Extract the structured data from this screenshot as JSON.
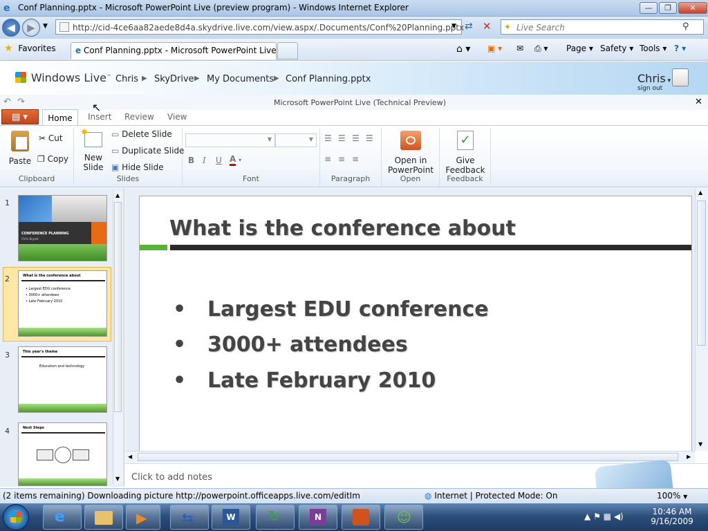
{
  "window": {
    "title": "Conf Planning.pptx - Microsoft PowerPoint Live (preview program) - Windows Internet Explorer"
  },
  "browser": {
    "url": "http://cid-4ce6aa82aede8d4a.skydrive.live.com/view.aspx/.Documents/Conf%20Planning.pptx",
    "search_placeholder": "Live Search",
    "favorites_label": "Favorites",
    "tab_title": "Conf Planning.pptx - Microsoft PowerPoint Live (...",
    "commands": [
      "Page",
      "Safety",
      "Tools"
    ]
  },
  "live": {
    "logo": "Windows Live",
    "breadcrumb": [
      "Chris",
      "SkyDrive",
      "My Documents",
      "Conf Planning.pptx"
    ],
    "user": "Chris",
    "signout": "sign out"
  },
  "app": {
    "title": "Microsoft PowerPoint Live (Technical Preview)"
  },
  "ribbon": {
    "tabs": [
      "Home",
      "Insert",
      "Review",
      "View"
    ],
    "clipboard": {
      "paste": "Paste",
      "cut": "Cut",
      "copy": "Copy",
      "label": "Clipboard"
    },
    "slides": {
      "new_slide_1": "New",
      "new_slide_2": "Slide",
      "delete": "Delete Slide",
      "duplicate": "Duplicate Slide",
      "hide": "Hide Slide",
      "label": "Slides"
    },
    "font": {
      "label": "Font",
      "bold": "B",
      "italic": "I",
      "underline": "U",
      "color": "A"
    },
    "paragraph": {
      "label": "Paragraph"
    },
    "open": {
      "btn_1": "Open in",
      "btn_2": "PowerPoint",
      "label": "Open"
    },
    "feedback": {
      "btn_1": "Give",
      "btn_2": "Feedback",
      "label": "Feedback"
    }
  },
  "thumbnails": [
    {
      "num": "1",
      "title": "CONFERENCE PLANNING",
      "sub": "Chris Bryant"
    },
    {
      "num": "2",
      "title": "What is the conference about",
      "bullets": [
        "Largest EDU conference",
        "3000+ attendees",
        "Late February 2010"
      ]
    },
    {
      "num": "3",
      "title": "This year's theme",
      "body": "Education and technology"
    },
    {
      "num": "4",
      "title": "Next Steps"
    }
  ],
  "slide": {
    "title": "What is the conference about",
    "bullets": [
      "Largest EDU conference",
      "3000+ attendees",
      "Late February 2010"
    ]
  },
  "notes_placeholder": "Click to add notes",
  "status": {
    "text": "(2 items remaining) Downloading picture http://powerpoint.officeapps.live.com/editIm",
    "zone": "Internet | Protected Mode: On",
    "zoom": "100%"
  },
  "taskbar": {
    "time": "10:46 AM",
    "date": "9/16/2009"
  },
  "colors": {
    "accent_green": "#55b533",
    "ribbon_file": "#d4541f",
    "selected_thumb": "#ffe7a6"
  }
}
